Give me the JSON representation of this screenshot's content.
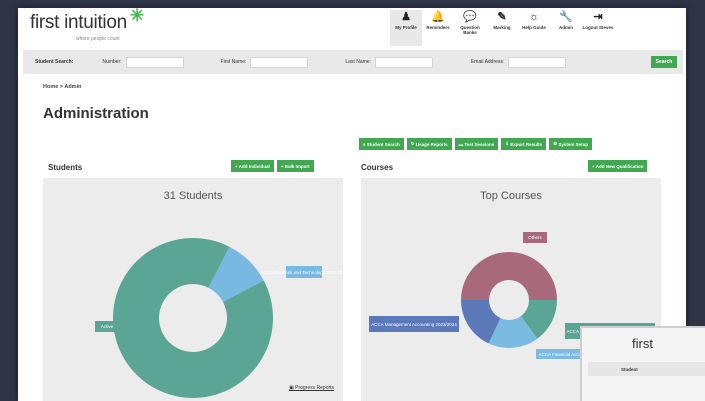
{
  "brand": {
    "name": "first intuition",
    "tagline": "where people count",
    "star": "✳"
  },
  "nav": [
    {
      "label": "My Profile",
      "icon": "♟",
      "active": true
    },
    {
      "label": "Reminders",
      "icon": "🔔",
      "active": false
    },
    {
      "label": "Question Banks",
      "icon": "💬",
      "active": false
    },
    {
      "label": "Marking",
      "icon": "✎",
      "active": false
    },
    {
      "label": "Help Guide",
      "icon": "☼",
      "active": false
    },
    {
      "label": "Admin",
      "icon": "🔧",
      "active": false
    },
    {
      "label": "Logout Steves",
      "icon": "⇥",
      "active": false
    }
  ],
  "search": {
    "title": "Student Search:",
    "number_label": "Number:",
    "first_name_label": "First Name:",
    "last_name_label": "Last Name:",
    "email_label": "Email Address:",
    "button": "Search"
  },
  "breadcrumb": "Home > Admin",
  "page_title": "Administration",
  "toolbar": [
    "Student Search",
    "Usage Reports",
    "Test Sessions",
    "Export Results",
    "System Setup"
  ],
  "students": {
    "section_title": "Students",
    "actions": [
      "+ Add Individual",
      "+ Bulk Import"
    ],
    "chart_title": "31 Students",
    "footer_link": "Progress Reports",
    "colors": {
      "active": "#5aa594",
      "not_active": "#79b8e0"
    }
  },
  "courses": {
    "section_title": "Courses",
    "actions": [
      "+ Add New Qualification"
    ],
    "chart_title": "Top Courses",
    "colors": {
      "others": "#a8697b",
      "management": "#5b78b8",
      "financial": "#7bbbe2",
      "business": "#5aa594"
    }
  },
  "chart_data": [
    {
      "type": "pie",
      "title": "31 Students",
      "categories": [
        "Active",
        "Not Active"
      ],
      "values": [
        28,
        3
      ]
    },
    {
      "type": "pie",
      "title": "Top Courses",
      "categories": [
        "Others",
        "ACCA Business and Technology 2023/2024",
        "ACCA Financial Accounting",
        "ACCA Management Accounting 2023/2024"
      ],
      "values": [
        50,
        15,
        17,
        18
      ]
    }
  ],
  "thumbnail": {
    "logo": "first",
    "bar_text": "Student"
  }
}
